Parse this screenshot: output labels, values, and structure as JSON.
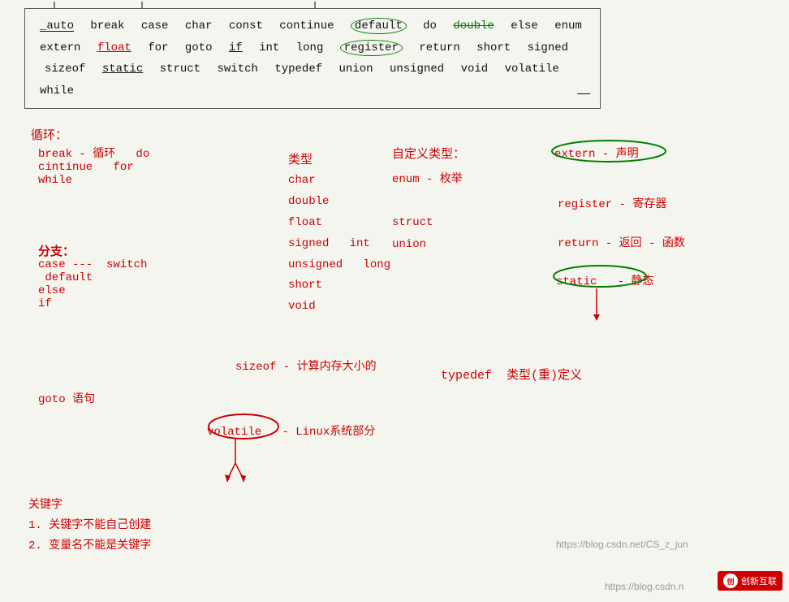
{
  "keyword_box": {
    "keywords": [
      {
        "text": "_auto",
        "style": "underline"
      },
      {
        "text": "break",
        "style": "normal"
      },
      {
        "text": "case",
        "style": "normal"
      },
      {
        "text": "char",
        "style": "normal"
      },
      {
        "text": "const",
        "style": "normal"
      },
      {
        "text": "continue",
        "style": "normal"
      },
      {
        "text": "default",
        "style": "circled-green"
      },
      {
        "text": "do",
        "style": "normal"
      },
      {
        "text": "double",
        "style": "green-strikethrough"
      },
      {
        "text": "else",
        "style": "normal"
      },
      {
        "text": "enum",
        "style": "normal"
      },
      {
        "text": "extern",
        "style": "normal"
      },
      {
        "text": "float",
        "style": "underline-red"
      },
      {
        "text": "for",
        "style": "normal"
      },
      {
        "text": "goto",
        "style": "normal"
      },
      {
        "text": "if",
        "style": "underline"
      },
      {
        "text": "int",
        "style": "normal"
      },
      {
        "text": "long",
        "style": "normal"
      },
      {
        "text": "register",
        "style": "circled-green"
      },
      {
        "text": "return",
        "style": "normal"
      },
      {
        "text": "short",
        "style": "normal"
      },
      {
        "text": "signed",
        "style": "normal"
      },
      {
        "text": "sizeof",
        "style": "normal"
      },
      {
        "text": "static",
        "style": "underline"
      },
      {
        "text": "struct",
        "style": "normal"
      },
      {
        "text": "switch",
        "style": "normal"
      },
      {
        "text": "typedef",
        "style": "normal"
      },
      {
        "text": "union",
        "style": "normal"
      },
      {
        "text": "unsigned",
        "style": "normal"
      },
      {
        "text": "void",
        "style": "normal"
      },
      {
        "text": "volatile",
        "style": "normal"
      },
      {
        "text": "while",
        "style": "normal"
      }
    ]
  },
  "sections": {
    "loop": {
      "title": "循环：",
      "items": [
        "break - 循环   do",
        "cintinue  for",
        "while"
      ]
    },
    "branch": {
      "title": "分支：",
      "items": [
        "case ---  switch",
        "default",
        "else",
        "if"
      ]
    },
    "type": {
      "title": "类型",
      "items": [
        "char",
        "double",
        "float",
        "signed   int",
        "unsigned   long",
        "short",
        "void"
      ]
    },
    "custom_type": {
      "title": "自定义类型：",
      "items": [
        "enum - 枚举",
        "struct",
        "union"
      ]
    },
    "sizeof": "sizeof - 计算内存大小的",
    "volatile": "volatile   - Linux系统部分",
    "typedef": "typedef  类型(重)定义",
    "goto": "goto 语句",
    "extern": "extern - 声明",
    "register": "register - 寄存器",
    "return": "return - 返回 - 函数",
    "static": "static  - 静态"
  },
  "footer": {
    "line1": "关键字",
    "line2": "1. 关键字不能自己创建",
    "line3": "2. 变量名不能是关键字"
  },
  "watermarks": [
    "https://blog.csdn.net/CS_z_jun",
    "https://blog.csdn.n"
  ]
}
